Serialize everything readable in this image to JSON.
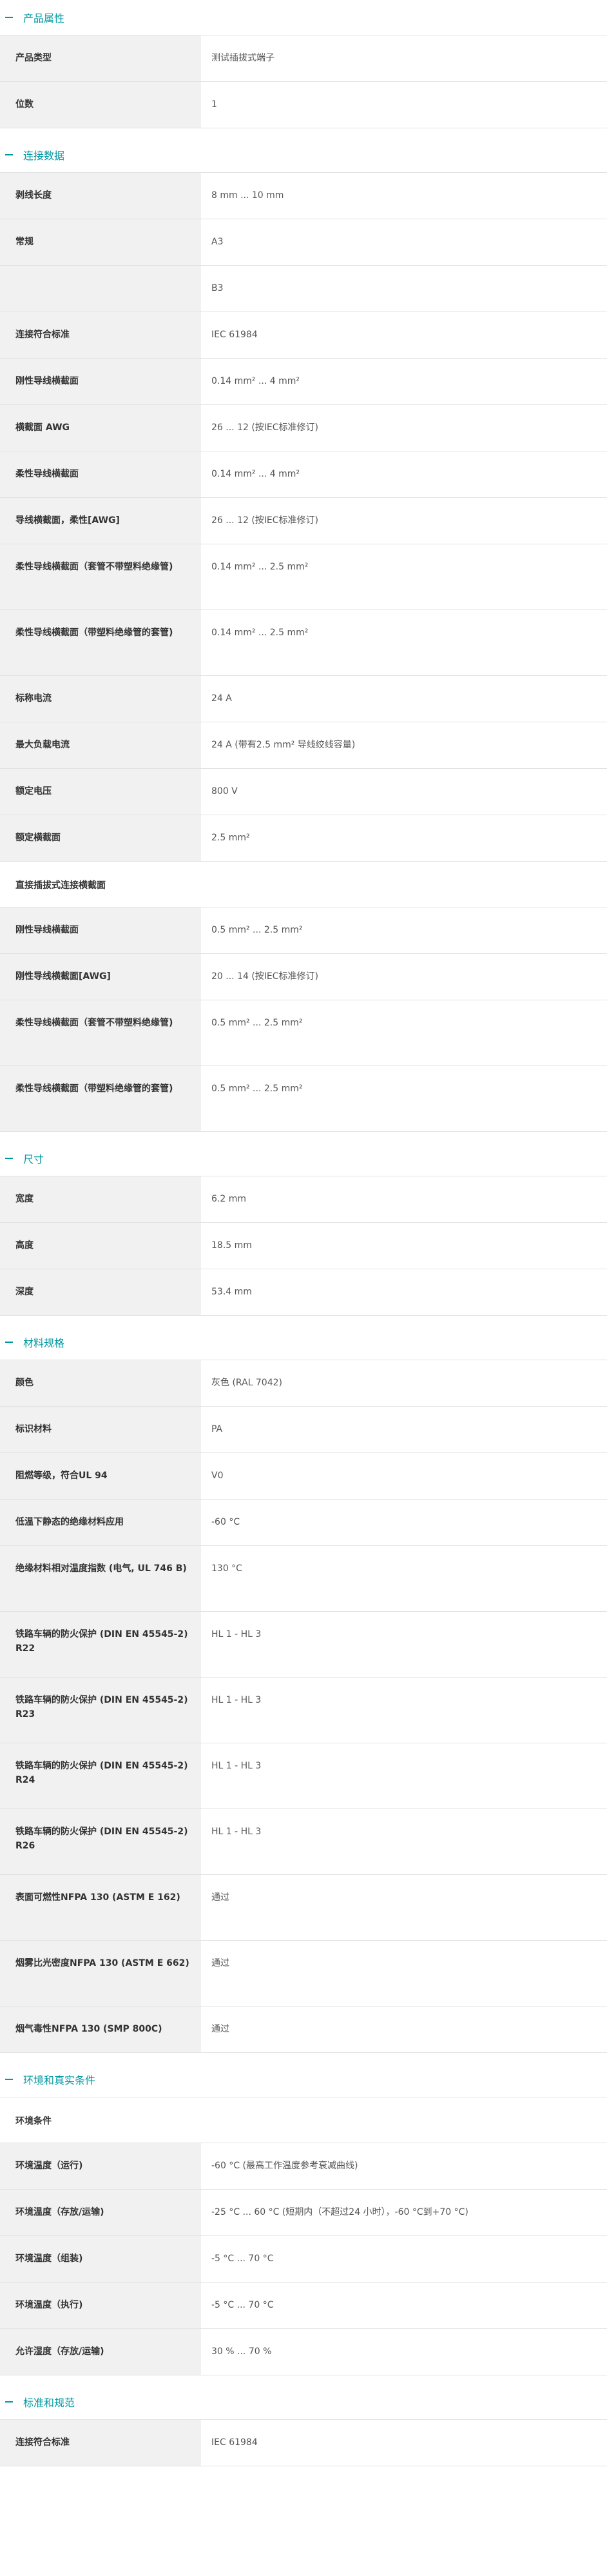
{
  "sections": [
    {
      "title": "产品属性",
      "rows": [
        {
          "label": "产品类型",
          "value": "测试插拔式端子"
        },
        {
          "label": "位数",
          "value": "1"
        }
      ]
    },
    {
      "title": "连接数据",
      "rows": [
        {
          "label": "剥线长度",
          "value": "8 mm ... 10 mm"
        },
        {
          "label": "常规",
          "value": "A3"
        },
        {
          "label": "",
          "value": "B3"
        },
        {
          "label": "连接符合标准",
          "value": "IEC 61984"
        },
        {
          "label": "刚性导线横截面",
          "value": "0.14 mm² ... 4 mm²"
        },
        {
          "label": "横截面 AWG",
          "value": "26 ... 12 (按IEC标准修订)"
        },
        {
          "label": "柔性导线横截面",
          "value": "0.14 mm² ... 4 mm²"
        },
        {
          "label": "导线横截面，柔性[AWG]",
          "value": "26 ... 12 (按IEC标准修订)"
        },
        {
          "label": "柔性导线横截面（套管不带塑料绝缘管)",
          "value": "0.14 mm² ... 2.5 mm²"
        },
        {
          "label": "柔性导线横截面（带塑料绝缘管的套管)",
          "value": "0.14 mm² ... 2.5 mm²"
        },
        {
          "label": "标称电流",
          "value": "24 A"
        },
        {
          "label": "最大负载电流",
          "value": "24 A (带有2.5 mm² 导线绞线容量)"
        },
        {
          "label": "额定电压",
          "value": "800 V"
        },
        {
          "label": "额定横截面",
          "value": "2.5 mm²"
        }
      ],
      "subhead": "直接插拔式连接横截面",
      "subrows": [
        {
          "label": "刚性导线横截面",
          "value": "0.5 mm² ... 2.5 mm²"
        },
        {
          "label": "刚性导线横截面[AWG]",
          "value": "20 ... 14 (按IEC标准修订)"
        },
        {
          "label": "柔性导线横截面（套管不带塑料绝缘管)",
          "value": "0.5 mm² ... 2.5 mm²"
        },
        {
          "label": "柔性导线横截面（带塑料绝缘管的套管)",
          "value": "0.5 mm² ... 2.5 mm²"
        }
      ]
    },
    {
      "title": "尺寸",
      "rows": [
        {
          "label": "宽度",
          "value": "6.2 mm"
        },
        {
          "label": "高度",
          "value": "18.5 mm"
        },
        {
          "label": "深度",
          "value": "53.4 mm"
        }
      ]
    },
    {
      "title": "材料规格",
      "rows": [
        {
          "label": "颜色",
          "value": "灰色 (RAL 7042)"
        },
        {
          "label": "标识材料",
          "value": "PA"
        },
        {
          "label": "阻燃等级，符合UL 94",
          "value": "V0"
        },
        {
          "label": "低温下静态的绝缘材料应用",
          "value": "-60 °C"
        },
        {
          "label": "绝缘材料相对温度指数 (电气, UL 746 B)",
          "value": "130 °C"
        },
        {
          "label": "铁路车辆的防火保护 (DIN EN 45545-2) R22",
          "value": "HL 1 - HL 3"
        },
        {
          "label": "铁路车辆的防火保护 (DIN EN 45545-2) R23",
          "value": "HL 1 - HL 3"
        },
        {
          "label": "铁路车辆的防火保护 (DIN EN 45545-2) R24",
          "value": "HL 1 - HL 3"
        },
        {
          "label": "铁路车辆的防火保护 (DIN EN 45545-2) R26",
          "value": "HL 1 - HL 3"
        },
        {
          "label": "表面可燃性NFPA 130 (ASTM E 162)",
          "value": "通过"
        },
        {
          "label": "烟雾比光密度NFPA 130 (ASTM E 662)",
          "value": "通过"
        },
        {
          "label": "烟气毒性NFPA 130 (SMP 800C)",
          "value": "通过"
        }
      ]
    },
    {
      "title": "环境和真实条件",
      "subhead_first": "环境条件",
      "rows": [
        {
          "label": "环境温度（运行)",
          "value": "-60 °C (最高工作温度参考衰减曲线)"
        },
        {
          "label": "环境温度（存放/运输)",
          "value": "-25 °C ... 60 °C (短期内（不超过24 小时），-60 °C到+70 °C)"
        },
        {
          "label": "环境温度（组装)",
          "value": "-5 °C ... 70 °C"
        },
        {
          "label": "环境温度（执行)",
          "value": "-5 °C ... 70 °C"
        },
        {
          "label": "允许湿度（存放/运输)",
          "value": "30 % ... 70 %"
        }
      ]
    },
    {
      "title": "标准和规范",
      "rows": [
        {
          "label": "连接符合标准",
          "value": "IEC 61984"
        }
      ]
    }
  ]
}
